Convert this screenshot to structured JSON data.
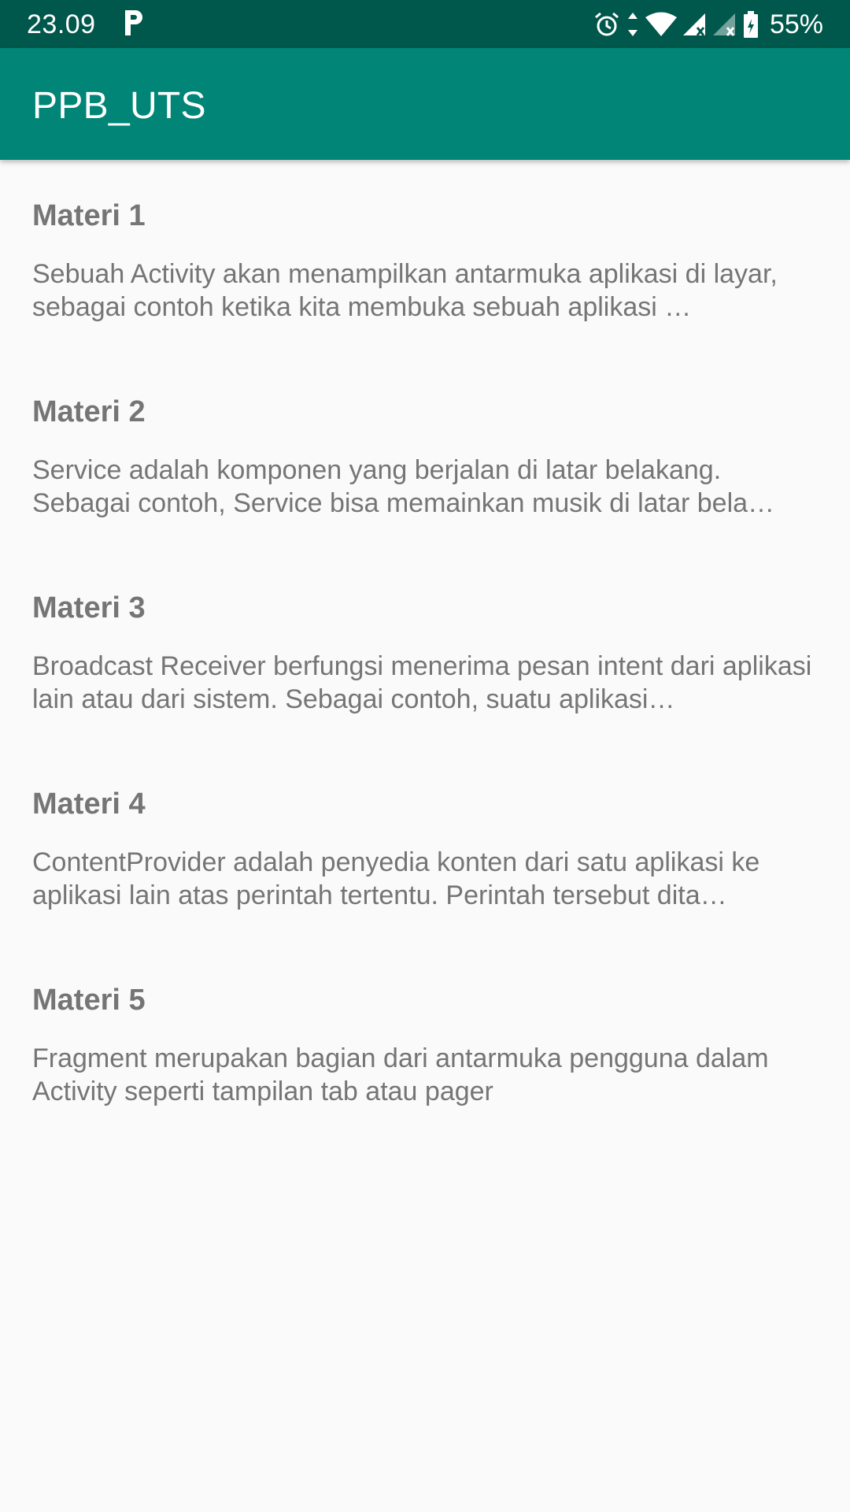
{
  "status_bar": {
    "time": "23.09",
    "battery": "55%",
    "icons": [
      "parking-app-icon",
      "alarm-icon",
      "data-arrows-icon",
      "wifi-icon",
      "signal-1-icon",
      "signal-2-icon",
      "battery-icon"
    ]
  },
  "app_bar": {
    "title": "PPB_UTS"
  },
  "items": [
    {
      "title": "Materi 1",
      "desc": "Sebuah Activity akan menampilkan antarmuka aplikasi di layar, sebagai contoh ketika kita membuka sebuah aplikasi …"
    },
    {
      "title": "Materi 2",
      "desc": "Service adalah komponen yang berjalan di latar belakang. Sebagai contoh, Service bisa memainkan musik di latar bela…"
    },
    {
      "title": "Materi 3",
      "desc": "Broadcast Receiver berfungsi menerima pesan intent dari aplikasi lain atau dari sistem. Sebagai contoh, suatu aplikasi…"
    },
    {
      "title": "Materi 4",
      "desc": "ContentProvider adalah penyedia konten dari satu aplikasi ke aplikasi lain atas perintah tertentu. Perintah tersebut dita…"
    },
    {
      "title": "Materi 5",
      "desc": "Fragment merupakan bagian dari antarmuka pengguna dalam Activity seperti tampilan tab atau pager"
    }
  ],
  "colors": {
    "status_bar": "#00574b",
    "app_bar": "#008577",
    "background": "#fafafa",
    "text": "#757575"
  }
}
